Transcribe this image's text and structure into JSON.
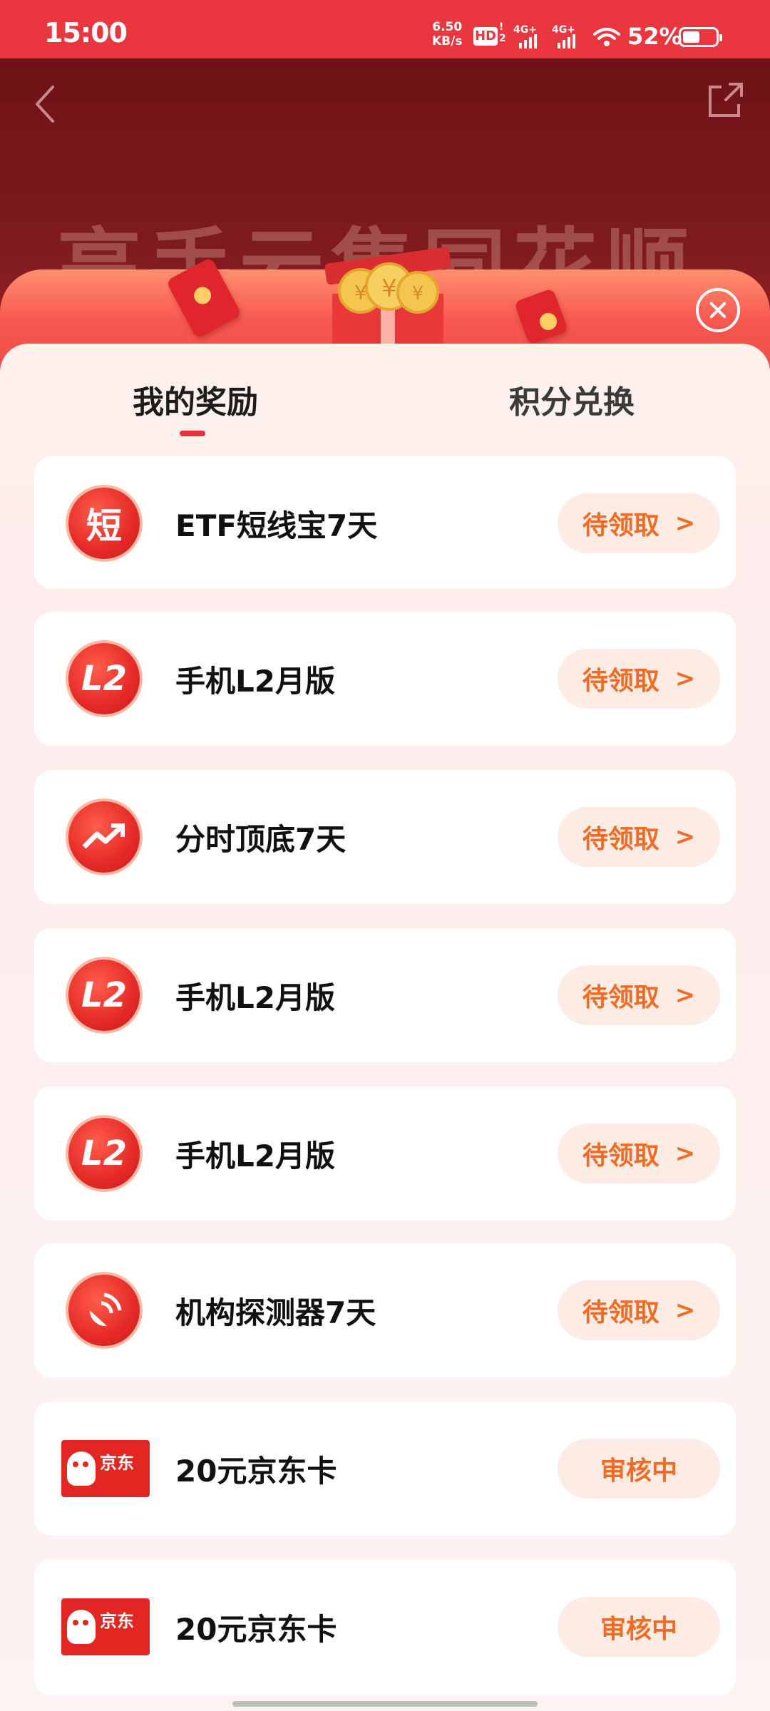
{
  "status_bar": {
    "time": "15:00",
    "net_speed_value": "6.50",
    "net_speed_unit": "KB/s",
    "hd_label": "HD",
    "hd_sub": "!\n2",
    "signal1_label": "4G+",
    "signal2_label": "4G+",
    "battery_percent": "52%",
    "battery_level": 0.52
  },
  "background": {
    "title": "亮手云集同花顺"
  },
  "modal": {
    "tabs": [
      {
        "label": "我的奖励",
        "active": true
      },
      {
        "label": "积分兑换",
        "active": false
      }
    ],
    "rewards": [
      {
        "icon": "short-char-icon",
        "icon_text": "短",
        "title": "ETF短线宝7天",
        "action": "待领取",
        "chevron": ">"
      },
      {
        "icon": "l2-icon",
        "icon_text": "L2",
        "title": "手机L2月版",
        "action": "待领取",
        "chevron": ">"
      },
      {
        "icon": "trend-chart-icon",
        "icon_text": "",
        "title": "分时顶底7天",
        "action": "待领取",
        "chevron": ">"
      },
      {
        "icon": "l2-icon",
        "icon_text": "L2",
        "title": "手机L2月版",
        "action": "待领取",
        "chevron": ">"
      },
      {
        "icon": "l2-icon",
        "icon_text": "L2",
        "title": "手机L2月版",
        "action": "待领取",
        "chevron": ">"
      },
      {
        "icon": "radar-icon",
        "icon_text": "",
        "title": "机构探测器7天",
        "action": "待领取",
        "chevron": ">"
      },
      {
        "icon": "jd-card-icon",
        "icon_text": "京东",
        "title": "20元京东卡",
        "action": "审核中",
        "chevron": ""
      },
      {
        "icon": "jd-card-icon",
        "icon_text": "京东",
        "title": "20元京东卡",
        "action": "审核中",
        "chevron": ""
      }
    ]
  },
  "colors": {
    "accent_red": "#e9363f",
    "action_orange": "#f26a24",
    "action_bg": "#fdece4"
  }
}
